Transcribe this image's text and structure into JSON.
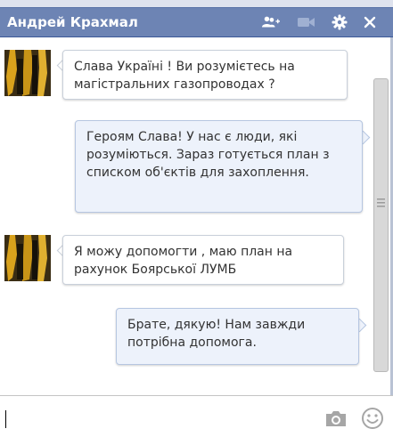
{
  "window": {
    "contact_name": "Андрей Крахмал"
  },
  "toolbar": {
    "add_people_icon": "add-people-icon",
    "video_icon": "video-camera-icon",
    "settings_icon": "gear-icon",
    "close_label": "×"
  },
  "messages": [
    {
      "direction": "incoming",
      "text": "Слава Україні ! Ви розумієтесь на магістральних газопроводах ?"
    },
    {
      "direction": "outgoing",
      "text": "Героям Слава! У нас є люди, які розуміються. Зараз готується план з списком об'єктів для захоплення."
    },
    {
      "direction": "incoming",
      "text": "Я можу допомогти , маю план на рахунок Боярської ЛУМБ"
    },
    {
      "direction": "outgoing",
      "text": "Брате, дякую! Нам завжди потрібна допомога."
    }
  ],
  "composer": {
    "value": "",
    "photo_icon": "camera-icon",
    "emoji_icon": "smiley-icon"
  },
  "colors": {
    "title_bar": "#6d84b4",
    "outgoing_bubble": "#edf2fb",
    "incoming_bubble": "#ffffff"
  }
}
